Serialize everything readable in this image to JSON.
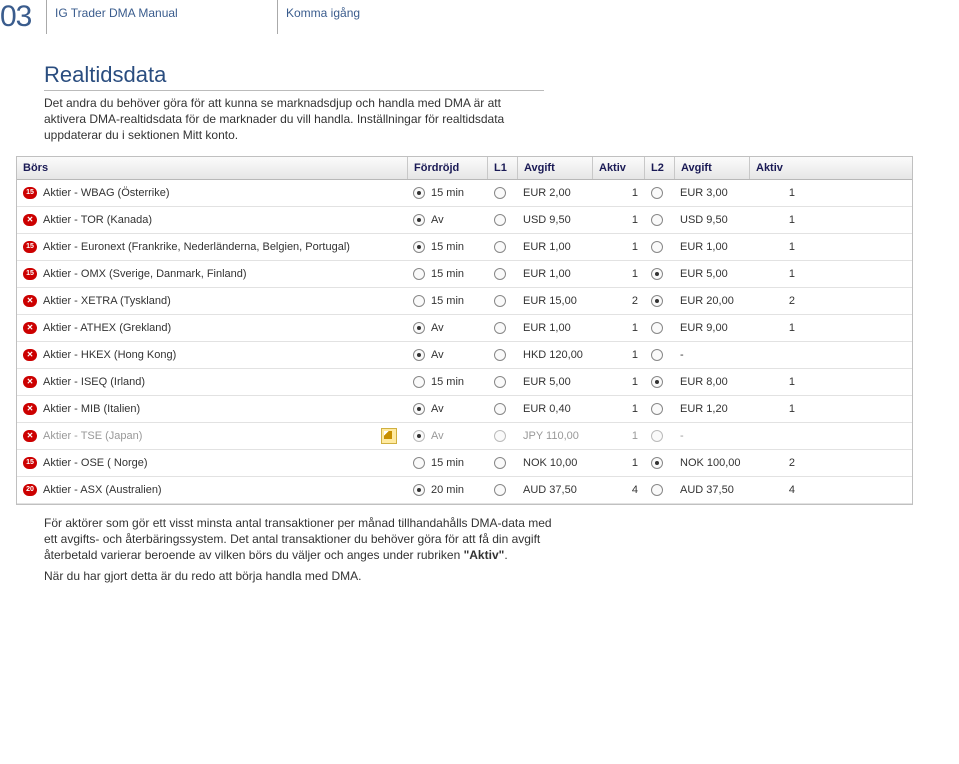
{
  "header": {
    "page_number": "03",
    "manual": "IG Trader DMA Manual",
    "section": "Komma igång"
  },
  "title": "Realtidsdata",
  "para1": "Det andra du behöver göra för att kunna se marknadsdjup och handla med DMA är att aktivera DMA-realtidsdata för de marknader du vill handla. Inställningar för realtidsdata uppdaterar du i sektionen Mitt konto.",
  "para2_pre": "För aktörer som gör ett visst minsta antal transaktioner per månad tillhandahålls DMA-data med ett avgifts- och återbäringssystem. Det antal transaktioner du behöver göra för att få din avgift återbetald varierar beroende av vilken börs du väljer och anges under rubriken ",
  "para2_bold": "\"Aktiv\"",
  "para2_post": ".",
  "note": "När du har gjort detta är du redo att börja handla med DMA.",
  "table": {
    "headers": {
      "bors": "Börs",
      "delay": "Fördröjd",
      "l1": "L1",
      "fee1": "Avgift",
      "aktiv1": "Aktiv",
      "l2": "L2",
      "fee2": "Avgift",
      "aktiv2": "Aktiv"
    },
    "rows": [
      {
        "badge": "15",
        "name": "Aktier - WBAG (Österrike)",
        "delay_sel": true,
        "delay": "15 min",
        "l1_sel": false,
        "fee1": "EUR 2,00",
        "aktiv1": "1",
        "l2_sel": false,
        "fee2": "EUR 3,00",
        "aktiv2": "1"
      },
      {
        "badge": "x",
        "name": "Aktier - TOR (Kanada)",
        "delay_sel": true,
        "delay": "Av",
        "l1_sel": false,
        "fee1": "USD 9,50",
        "aktiv1": "1",
        "l2_sel": false,
        "fee2": "USD 9,50",
        "aktiv2": "1"
      },
      {
        "badge": "15",
        "name": "Aktier - Euronext (Frankrike, Nederländerna, Belgien, Portugal)",
        "delay_sel": true,
        "delay": "15 min",
        "l1_sel": false,
        "fee1": "EUR 1,00",
        "aktiv1": "1",
        "l2_sel": false,
        "fee2": "EUR 1,00",
        "aktiv2": "1"
      },
      {
        "badge": "15",
        "name": "Aktier - OMX (Sverige, Danmark, Finland)",
        "delay_sel": false,
        "delay": "15 min",
        "l1_sel": false,
        "fee1": "EUR 1,00",
        "aktiv1": "1",
        "l2_sel": true,
        "fee2": "EUR 5,00",
        "aktiv2": "1"
      },
      {
        "badge": "x",
        "name": "Aktier - XETRA (Tyskland)",
        "delay_sel": false,
        "delay": "15 min",
        "l1_sel": false,
        "fee1": "EUR 15,00",
        "aktiv1": "2",
        "l2_sel": true,
        "fee2": "EUR 20,00",
        "aktiv2": "2"
      },
      {
        "badge": "x",
        "name": "Aktier - ATHEX (Grekland)",
        "delay_sel": true,
        "delay": "Av",
        "l1_sel": false,
        "fee1": "EUR 1,00",
        "aktiv1": "1",
        "l2_sel": false,
        "fee2": "EUR 9,00",
        "aktiv2": "1"
      },
      {
        "badge": "x",
        "name": "Aktier - HKEX (Hong Kong)",
        "delay_sel": true,
        "delay": "Av",
        "l1_sel": false,
        "fee1": "HKD 120,00",
        "aktiv1": "1",
        "l2_sel": false,
        "fee2": "-",
        "aktiv2": ""
      },
      {
        "badge": "x",
        "name": "Aktier - ISEQ (Irland)",
        "delay_sel": false,
        "delay": "15 min",
        "l1_sel": false,
        "fee1": "EUR 5,00",
        "aktiv1": "1",
        "l2_sel": true,
        "fee2": "EUR 8,00",
        "aktiv2": "1"
      },
      {
        "badge": "x",
        "name": "Aktier - MIB (Italien)",
        "delay_sel": true,
        "delay": "Av",
        "l1_sel": false,
        "fee1": "EUR 0,40",
        "aktiv1": "1",
        "l2_sel": false,
        "fee2": "EUR 1,20",
        "aktiv2": "1"
      },
      {
        "badge": "x",
        "name": "Aktier - TSE (Japan)",
        "delay_sel": true,
        "delay": "Av",
        "l1_sel": false,
        "fee1": "JPY 110,00",
        "aktiv1": "1",
        "l2_sel": false,
        "fee2": "-",
        "aktiv2": "",
        "grey": true,
        "edit": true
      },
      {
        "badge": "15",
        "name": "Aktier - OSE ( Norge)",
        "delay_sel": false,
        "delay": "15 min",
        "l1_sel": false,
        "fee1": "NOK 10,00",
        "aktiv1": "1",
        "l2_sel": true,
        "fee2": "NOK 100,00",
        "aktiv2": "2"
      },
      {
        "badge": "20",
        "name": "Aktier - ASX (Australien)",
        "delay_sel": true,
        "delay": "20 min",
        "l1_sel": false,
        "fee1": "AUD 37,50",
        "aktiv1": "4",
        "l2_sel": false,
        "fee2": "AUD 37,50",
        "aktiv2": "4"
      }
    ]
  }
}
